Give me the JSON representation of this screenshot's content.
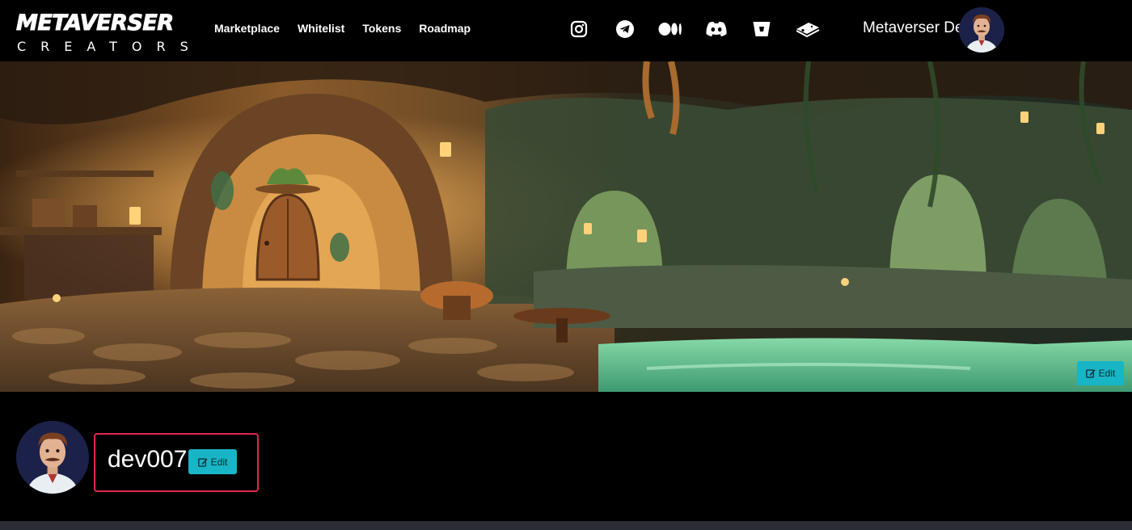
{
  "brand": {
    "logo_top": "METAVERSER",
    "logo_bottom": "CREATORS"
  },
  "nav": {
    "items": [
      {
        "label": "Marketplace"
      },
      {
        "label": "Whitelist"
      },
      {
        "label": "Tokens"
      },
      {
        "label": "Roadmap"
      }
    ]
  },
  "socials": [
    {
      "icon": "instagram-icon"
    },
    {
      "icon": "telegram-icon"
    },
    {
      "icon": "medium-icon"
    },
    {
      "icon": "discord-icon"
    },
    {
      "icon": "bitbucket-icon"
    },
    {
      "icon": "gitbook-icon"
    }
  ],
  "user": {
    "name": "Metaverser Dev"
  },
  "banner": {
    "edit_label": "Edit"
  },
  "profile": {
    "username": "dev007",
    "edit_label": "Edit"
  },
  "colors": {
    "accent": "#17b5c6",
    "highlight_border": "#e0284a",
    "background": "#000000"
  }
}
